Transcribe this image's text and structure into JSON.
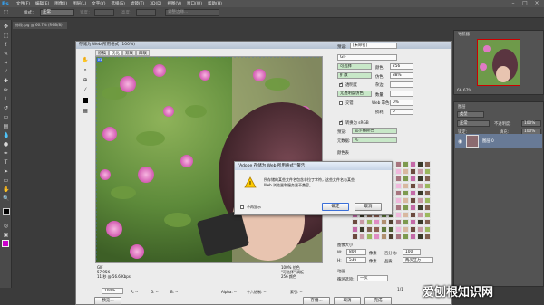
{
  "app": {
    "name": "Ps"
  },
  "menu": [
    "文件(F)",
    "编辑(E)",
    "图像(I)",
    "图层(L)",
    "文字(Y)",
    "选择(S)",
    "滤镜(T)",
    "3D(D)",
    "视图(V)",
    "窗口(W)",
    "帮助(H)"
  ],
  "options_bar": {
    "style_label": "样式：",
    "style_value": "正常",
    "width_label": "宽度：",
    "height_label": "高度：",
    "refine_button": "调整边缘..."
  },
  "doc_tab": "修改.jpg @ 66.7% (RGB/8)",
  "dialog": {
    "title": "存储为 Web 所用格式 (100%)",
    "tabs": [
      "原稿",
      "优化",
      "双联",
      "四联"
    ],
    "preset_label": "预设:",
    "preset_value": "[未命名]",
    "format_value": "GIF",
    "reduction_value": "可选择",
    "dither_algo_value": "扩散",
    "transparency_label": "透明度",
    "matte_value": "无透明度仿色",
    "interlaced_label": "交错",
    "colors_label": "颜色:",
    "colors_value": "256",
    "dither_label": "仿色:",
    "dither_value": "88%",
    "matte_label": "杂边:",
    "amount_label": "数量:",
    "websnap_label": "Web 靠色:",
    "websnap_value": "0%",
    "lossy_label": "损耗:",
    "lossy_value": "0",
    "convert_srgb_label": "转换为 sRGB",
    "preview_label": "预览:",
    "preview_value": "显示器颜色",
    "metadata_label": "元数据:",
    "metadata_value": "无",
    "color_table_label": "颜色表",
    "image_size_label": "图像大小",
    "width_label": "W:",
    "width_value": "800",
    "height_label": "H:",
    "height_value": "536",
    "unit_label": "像素",
    "percent_label": "百分比:",
    "percent_value": "100",
    "quality_label": "品质:",
    "quality_value": "两次立方",
    "animation_label": "动画",
    "loop_label": "循环选项:",
    "loop_value": "一次",
    "frame_counter": "1/1",
    "info_left": [
      "GIF",
      "57.95K",
      "11 秒 @ 56.6 Kbps"
    ],
    "info_right": [
      "100% 仿色",
      "\"可选择\" 调板",
      "256 颜色"
    ],
    "zoom_value": "100%",
    "status": [
      "R: --",
      "G: --",
      "B: --",
      "Alpha: --",
      "十六进制: --",
      "索引: --"
    ],
    "preview_button": "预览...",
    "save_button": "存储...",
    "cancel_button": "取消",
    "done_button": "完成"
  },
  "alert": {
    "title": "\"Adobe 存储为 Web 所用格式\" 警告",
    "message_line1": "所存储的某些文件名包含非拉丁字符，这些文件名与某些",
    "message_line2": "Web 浏览器和服务器不兼容。",
    "checkbox_label": "不再显示",
    "ok_button": "确定",
    "cancel_button": "取消"
  },
  "navigator": {
    "tab1": "导航器",
    "zoom": "66.67%"
  },
  "layers": {
    "tab": "图层",
    "filter": "类型",
    "blend_mode": "正常",
    "opacity_label": "不透明度:",
    "opacity_value": "100%",
    "lock_label": "锁定:",
    "fill_label": "填充:",
    "fill_value": "100%",
    "layer_name": "图层 0"
  },
  "watermark": "爱刨根知识网",
  "colors": {
    "accent_green": "#c8e8c8",
    "foreground": "#000000",
    "background": "#ffffff",
    "swatch_accent": "#cc00cc"
  }
}
